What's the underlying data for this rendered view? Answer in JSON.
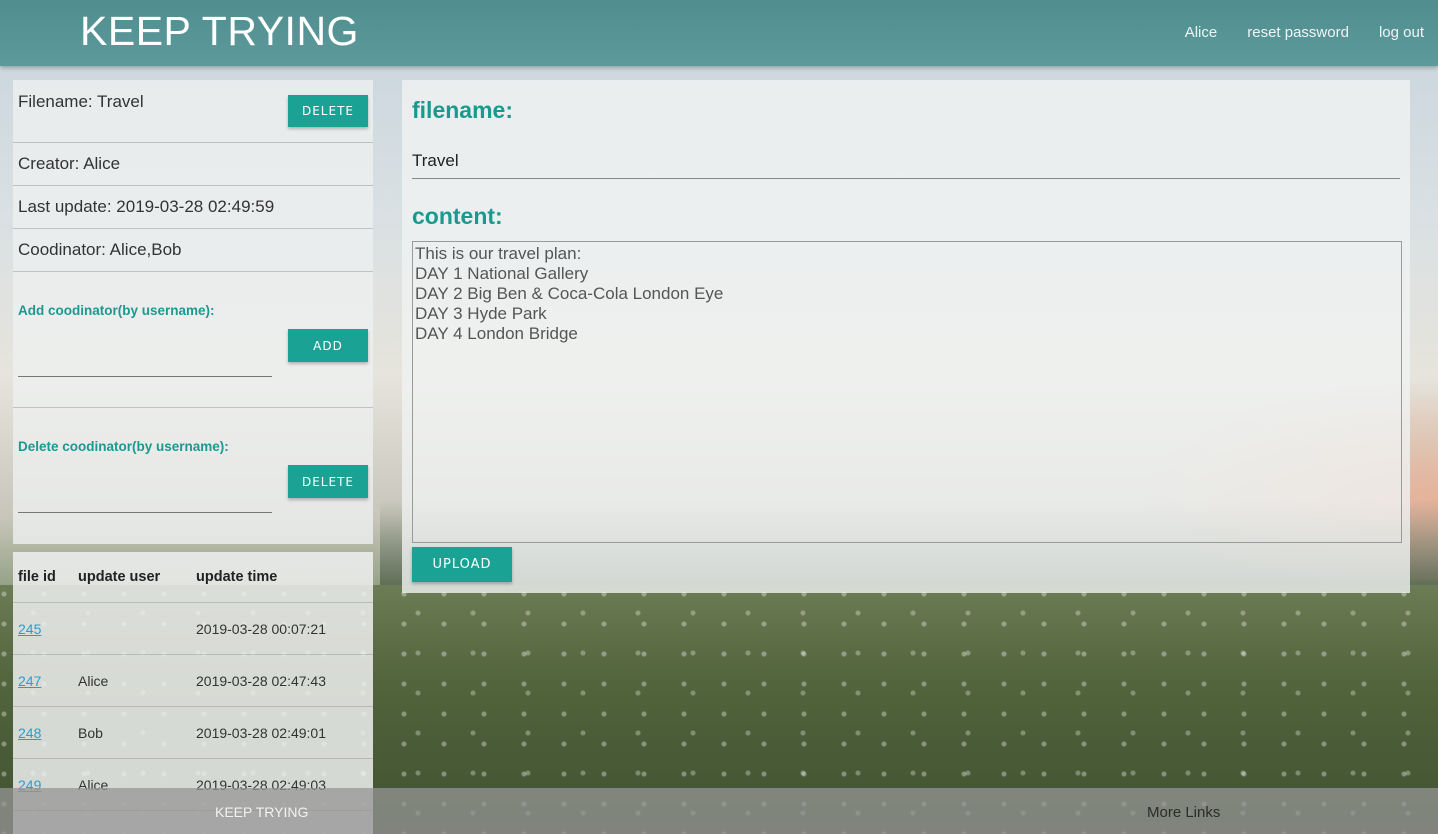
{
  "header": {
    "brand": "KEEP TRYING",
    "nav": {
      "user": "Alice",
      "reset": "reset password",
      "logout": "log out"
    }
  },
  "file_meta": {
    "filename_line": "Filename: Travel",
    "delete_label": "DELETE",
    "creator_line": "Creator: Alice",
    "last_update_line": "Last update: 2019-03-28 02:49:59",
    "coordinator_line": "Coodinator: Alice,Bob"
  },
  "add_coordinator": {
    "label": "Add coodinator(by username):",
    "value": "",
    "button": "ADD"
  },
  "delete_coordinator": {
    "label": "Delete coodinator(by username):",
    "value": "",
    "button": "DELETE"
  },
  "history_table": {
    "headers": [
      "file id",
      "update user",
      "update time"
    ],
    "rows": [
      {
        "id": "245",
        "user": "",
        "time": "2019-03-28 00:07:21"
      },
      {
        "id": "247",
        "user": "Alice",
        "time": "2019-03-28 02:47:43"
      },
      {
        "id": "248",
        "user": "Bob",
        "time": "2019-03-28 02:49:01"
      },
      {
        "id": "249",
        "user": "Alice",
        "time": "2019-03-28 02:49:03"
      }
    ]
  },
  "editor": {
    "filename_label": "filename:",
    "filename_value": "Travel",
    "content_label": "content:",
    "content_value": "This is our travel plan:\nDAY 1 National Gallery\nDAY 2 Big Ben & Coca-Cola London Eye\nDAY 3 Hyde Park\nDAY 4 London Bridge",
    "upload_label": "UPLOAD"
  },
  "footer": {
    "brand": "KEEP TRYING",
    "links": "More Links"
  },
  "colors": {
    "accent": "#1aa394",
    "header": "#5a9597",
    "link": "#2a9cd0"
  }
}
